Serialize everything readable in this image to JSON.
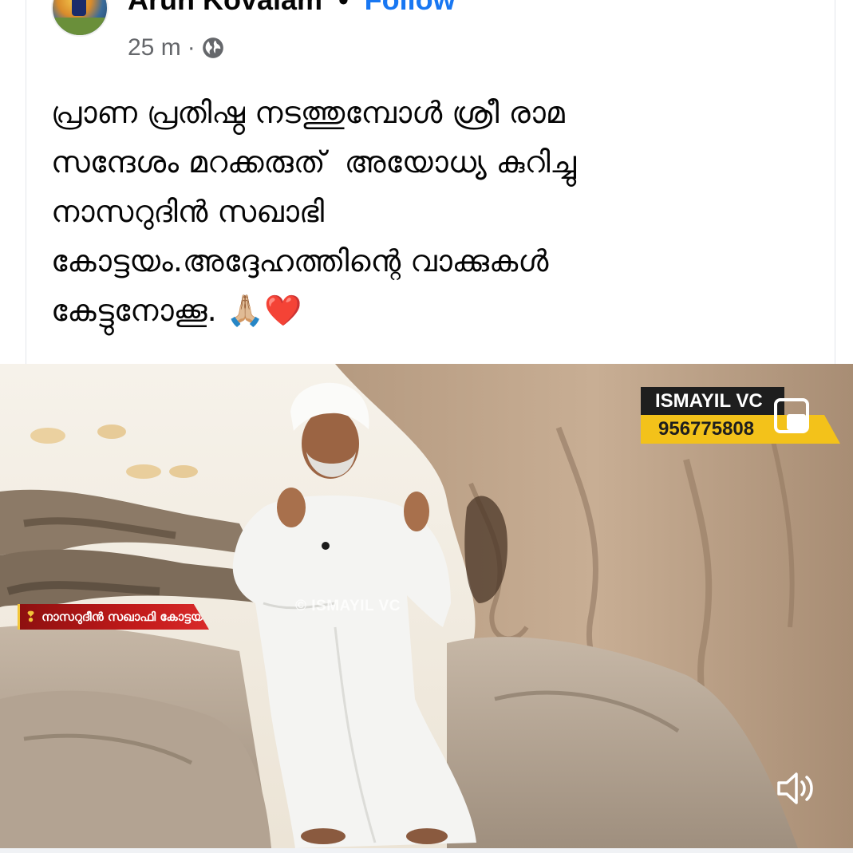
{
  "post": {
    "author": "Arun Kovalam",
    "separator": "•",
    "follow_label": "Follow",
    "time": "25 m",
    "meta_separator": "·",
    "privacy_icon": "globe-icon",
    "text": "പ്രാണ പ്രതിഷ്ഠ നടത്തുമ്പോൾ ശ്രീ രാമ\nസന്ദേശം മറക്കരുത്  അയോധ്യ കുറിച്ചു\nനാസറുദിൻ സഖാഭി\nകോട്ടയം.അദ്ദേഹത്തിന്റെ വാക്കുകൾ\nകേട്ടുനോക്കൂ. 🙏🏼❤️"
  },
  "video": {
    "brand_name": "ISMAYIL VC",
    "brand_phone": "956775808",
    "caption": "നാസറുദീൻ സഖാഫി കോട്ടയം",
    "watermark": "© ISMAYIL VC",
    "controls": {
      "pip_icon": "picture-in-picture-icon",
      "volume_icon": "volume-icon"
    }
  },
  "colors": {
    "follow": "#1877f2",
    "meta": "#65676b",
    "text": "#050505",
    "brand_yellow": "#f3c21a",
    "caption_red": "#c11a1a"
  }
}
